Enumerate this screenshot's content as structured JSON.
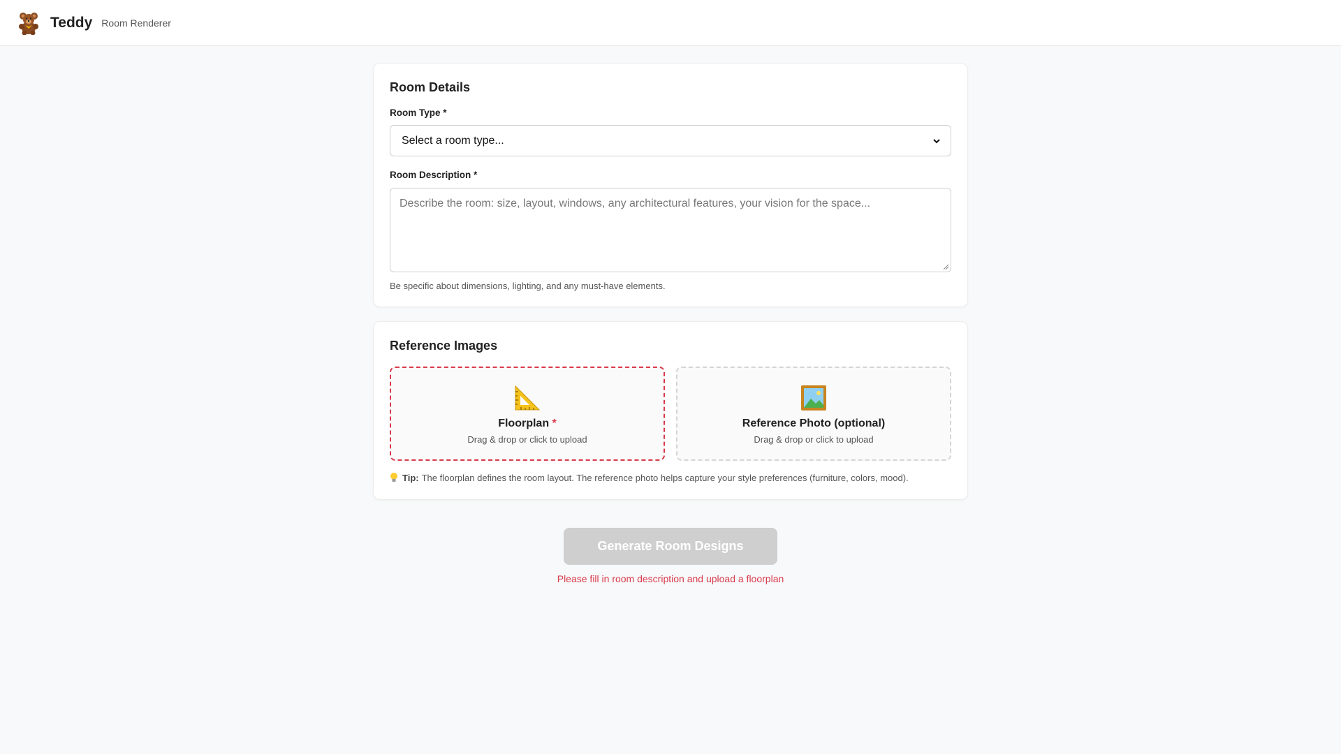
{
  "header": {
    "logo_icon": "teddy-bear-icon",
    "app_name": "Teddy",
    "app_subtitle": "Room Renderer"
  },
  "room_details": {
    "title": "Room Details",
    "room_type_label": "Room Type *",
    "room_type_value": "Select a room type...",
    "room_description_label": "Room Description *",
    "room_description_placeholder": "Describe the room: size, layout, windows, any architectural features, your vision for the space...",
    "room_description_value": "",
    "hint": "Be specific about dimensions, lighting, and any must-have elements."
  },
  "reference_images": {
    "title": "Reference Images",
    "floorplan": {
      "icon": "triangular-ruler-icon",
      "title": "Floorplan",
      "required_mark": "*",
      "subtitle": "Drag & drop or click to upload"
    },
    "reference_photo": {
      "icon": "framed-picture-icon",
      "title": "Reference Photo (optional)",
      "subtitle": "Drag & drop or click to upload"
    },
    "tip_icon": "light-bulb-icon",
    "tip_label": "Tip:",
    "tip_text": "The floorplan defines the room layout. The reference photo helps capture your style preferences (furniture, colors, mood)."
  },
  "actions": {
    "generate_label": "Generate Room Designs",
    "error_message": "Please fill in room description and upload a floorplan"
  },
  "colors": {
    "accent_error": "#d93a4b",
    "button_disabled": "#cfcfcf",
    "page_background": "#f8f9fa"
  }
}
